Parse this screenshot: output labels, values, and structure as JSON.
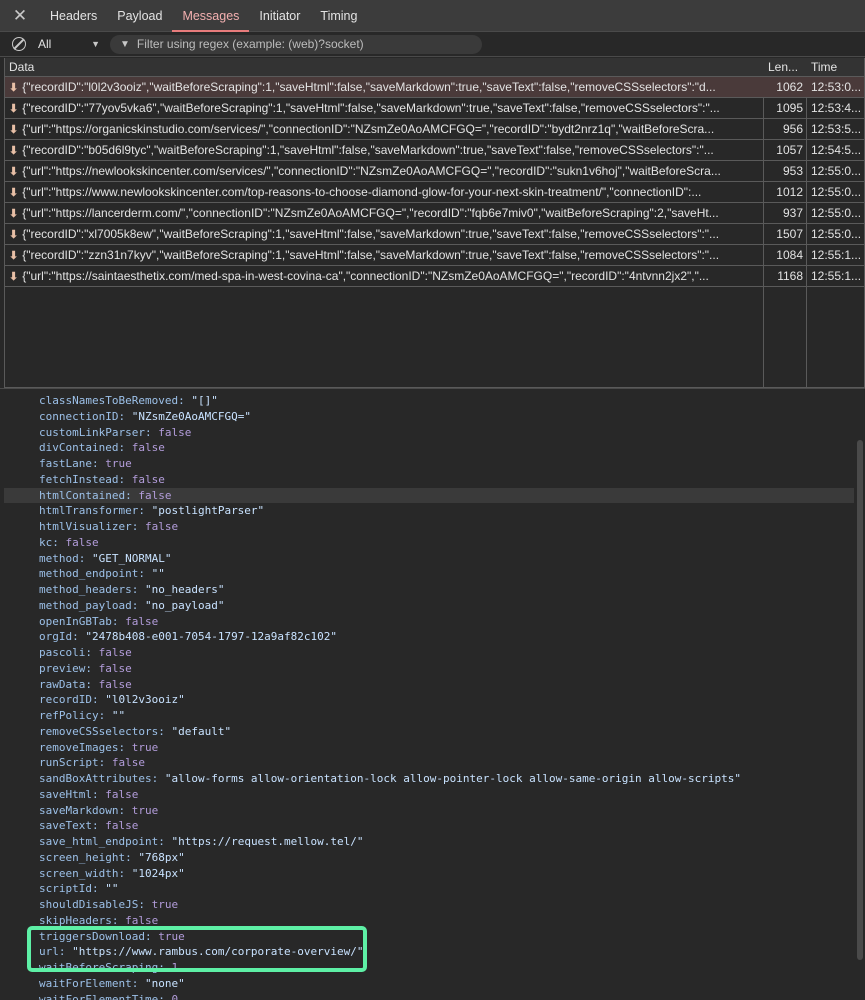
{
  "tabs": {
    "close": "✕",
    "items": [
      "Headers",
      "Payload",
      "Messages",
      "Initiator",
      "Timing"
    ]
  },
  "filter": {
    "type_value": "All",
    "placeholder": "Filter using regex (example: (web)?socket)"
  },
  "table": {
    "headers": [
      "Data",
      "Len...",
      "Time"
    ],
    "rows": [
      {
        "data": "{\"recordID\":\"l0l2v3ooiz\",\"waitBeforeScraping\":1,\"saveHtml\":false,\"saveMarkdown\":true,\"saveText\":false,\"removeCSSselectors\":\"d...",
        "len": "1062",
        "time": "12:53:0..."
      },
      {
        "data": "{\"recordID\":\"77yov5vka6\",\"waitBeforeScraping\":1,\"saveHtml\":false,\"saveMarkdown\":true,\"saveText\":false,\"removeCSSselectors\":\"...",
        "len": "1095",
        "time": "12:53:4..."
      },
      {
        "data": "{\"url\":\"https://organicskinstudio.com/services/\",\"connectionID\":\"NZsmZe0AoAMCFGQ=\",\"recordID\":\"bydt2nrz1q\",\"waitBeforeScra...",
        "len": "956",
        "time": "12:53:5..."
      },
      {
        "data": "{\"recordID\":\"b05d6l9tyc\",\"waitBeforeScraping\":1,\"saveHtml\":false,\"saveMarkdown\":true,\"saveText\":false,\"removeCSSselectors\":\"...",
        "len": "1057",
        "time": "12:54:5..."
      },
      {
        "data": "{\"url\":\"https://newlookskincenter.com/services/\",\"connectionID\":\"NZsmZe0AoAMCFGQ=\",\"recordID\":\"sukn1v6hoj\",\"waitBeforeScra...",
        "len": "953",
        "time": "12:55:0..."
      },
      {
        "data": "{\"url\":\"https://www.newlookskincenter.com/top-reasons-to-choose-diamond-glow-for-your-next-skin-treatment/\",\"connectionID\":...",
        "len": "1012",
        "time": "12:55:0..."
      },
      {
        "data": "{\"url\":\"https://lancerderm.com/\",\"connectionID\":\"NZsmZe0AoAMCFGQ=\",\"recordID\":\"fqb6e7miv0\",\"waitBeforeScraping\":2,\"saveHt...",
        "len": "937",
        "time": "12:55:0..."
      },
      {
        "data": "{\"recordID\":\"xl7005k8ew\",\"waitBeforeScraping\":1,\"saveHtml\":false,\"saveMarkdown\":true,\"saveText\":false,\"removeCSSselectors\":\"...",
        "len": "1507",
        "time": "12:55:0..."
      },
      {
        "data": "{\"recordID\":\"zzn31n7kyv\",\"waitBeforeScraping\":1,\"saveHtml\":false,\"saveMarkdown\":true,\"saveText\":false,\"removeCSSselectors\":\"...",
        "len": "1084",
        "time": "12:55:1..."
      },
      {
        "data": "{\"url\":\"https://saintaesthetix.com/med-spa-in-west-covina-ca\",\"connectionID\":\"NZsmZe0AoAMCFGQ=\",\"recordID\":\"4ntvnn2jx2\",\"...",
        "len": "1168",
        "time": "12:55:1..."
      }
    ]
  },
  "details": [
    {
      "key": "classNamesToBeRemoved",
      "value": "\"[]\"",
      "kind": "s"
    },
    {
      "key": "connectionID",
      "value": "\"NZsmZe0AoAMCFGQ=\"",
      "kind": "s"
    },
    {
      "key": "customLinkParser",
      "value": "false",
      "kind": "b"
    },
    {
      "key": "divContained",
      "value": "false",
      "kind": "b"
    },
    {
      "key": "fastLane",
      "value": "true",
      "kind": "b"
    },
    {
      "key": "fetchInstead",
      "value": "false",
      "kind": "b"
    },
    {
      "key": "htmlContained",
      "value": "false",
      "kind": "b"
    },
    {
      "key": "htmlTransformer",
      "value": "\"postlightParser\"",
      "kind": "s"
    },
    {
      "key": "htmlVisualizer",
      "value": "false",
      "kind": "b"
    },
    {
      "key": "kc",
      "value": "false",
      "kind": "b"
    },
    {
      "key": "method",
      "value": "\"GET_NORMAL\"",
      "kind": "s"
    },
    {
      "key": "method_endpoint",
      "value": "\"\"",
      "kind": "s"
    },
    {
      "key": "method_headers",
      "value": "\"no_headers\"",
      "kind": "s"
    },
    {
      "key": "method_payload",
      "value": "\"no_payload\"",
      "kind": "s"
    },
    {
      "key": "openInGBTab",
      "value": "false",
      "kind": "b"
    },
    {
      "key": "orgId",
      "value": "\"2478b408-e001-7054-1797-12a9af82c102\"",
      "kind": "s"
    },
    {
      "key": "pascoli",
      "value": "false",
      "kind": "b"
    },
    {
      "key": "preview",
      "value": "false",
      "kind": "b"
    },
    {
      "key": "rawData",
      "value": "false",
      "kind": "b"
    },
    {
      "key": "recordID",
      "value": "\"l0l2v3ooiz\"",
      "kind": "s"
    },
    {
      "key": "refPolicy",
      "value": "\"\"",
      "kind": "s"
    },
    {
      "key": "removeCSSselectors",
      "value": "\"default\"",
      "kind": "s"
    },
    {
      "key": "removeImages",
      "value": "true",
      "kind": "b"
    },
    {
      "key": "runScript",
      "value": "false",
      "kind": "b"
    },
    {
      "key": "sandBoxAttributes",
      "value": "\"allow-forms allow-orientation-lock allow-pointer-lock allow-same-origin allow-scripts\"",
      "kind": "s"
    },
    {
      "key": "saveHtml",
      "value": "false",
      "kind": "b"
    },
    {
      "key": "saveMarkdown",
      "value": "true",
      "kind": "b"
    },
    {
      "key": "saveText",
      "value": "false",
      "kind": "b"
    },
    {
      "key": "save_html_endpoint",
      "value": "\"https://request.mellow.tel/\"",
      "kind": "s"
    },
    {
      "key": "screen_height",
      "value": "\"768px\"",
      "kind": "s"
    },
    {
      "key": "screen_width",
      "value": "\"1024px\"",
      "kind": "s"
    },
    {
      "key": "scriptId",
      "value": "\"\"",
      "kind": "s"
    },
    {
      "key": "shouldDisableJS",
      "value": "true",
      "kind": "b"
    },
    {
      "key": "skipHeaders",
      "value": "false",
      "kind": "b"
    },
    {
      "key": "triggersDownload",
      "value": "true",
      "kind": "b"
    },
    {
      "key": "url",
      "value": "\"https://www.rambus.com/corporate-overview/\"",
      "kind": "s"
    },
    {
      "key": "waitBeforeScraping",
      "value": "1",
      "kind": "n"
    },
    {
      "key": "waitForElement",
      "value": "\"none\"",
      "kind": "s"
    },
    {
      "key": "waitForElementTime",
      "value": "0",
      "kind": "n"
    }
  ],
  "colors": {
    "highlight_box": "#5ef0a6",
    "active_tab": "#e87c7c"
  }
}
